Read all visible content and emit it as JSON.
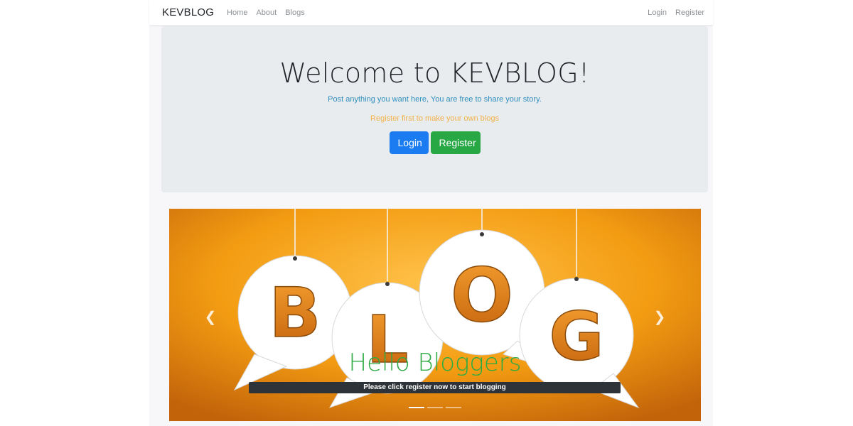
{
  "navbar": {
    "brand": "KEVBLOG",
    "links": [
      "Home",
      "About",
      "Blogs"
    ],
    "auth_links": [
      "Login",
      "Register"
    ]
  },
  "jumbotron": {
    "title": "Welcome to KEVBLOG!",
    "lead": "Post anything you want here, You are free to share your story.",
    "note": "Register first to make your own blogs",
    "login_label": "Login",
    "register_label": "Register"
  },
  "carousel": {
    "prev_icon": "chevron-left-icon",
    "next_icon": "chevron-right-icon",
    "caption_title": "Hello Bloggers",
    "caption_text": "Please click register now to start blogging",
    "slide_count": 3,
    "active_slide": 1,
    "image_letters": [
      "B",
      "L",
      "O",
      "G"
    ]
  },
  "colors": {
    "primary": "#1a7cf0",
    "success": "#28a745",
    "jumbotron_bg": "#e9ecef",
    "lead_text": "#2f8fbb",
    "note_text": "#f0b24a",
    "caption_title": "#2eaa44",
    "slide_orange": "#f39c12"
  }
}
